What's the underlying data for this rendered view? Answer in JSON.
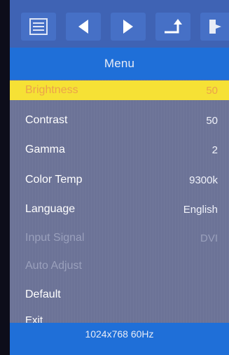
{
  "toolbar": {
    "buttons": [
      {
        "icon": "menu-list-icon"
      },
      {
        "icon": "arrow-left-icon"
      },
      {
        "icon": "arrow-right-icon"
      },
      {
        "icon": "enter-return-icon"
      },
      {
        "icon": "exit-door-icon"
      }
    ]
  },
  "menu": {
    "title": "Menu",
    "items": [
      {
        "label": "Brightness",
        "value": "50",
        "state": "selected"
      },
      {
        "label": "Contrast",
        "value": "50",
        "state": "normal"
      },
      {
        "label": "Gamma",
        "value": "2",
        "state": "normal"
      },
      {
        "label": "Color Temp",
        "value": "9300k",
        "state": "normal"
      },
      {
        "label": "Language",
        "value": "English",
        "state": "normal"
      },
      {
        "label": "Input Signal",
        "value": "DVI",
        "state": "disabled"
      },
      {
        "label": "Auto Adjust",
        "value": "",
        "state": "disabled"
      },
      {
        "label": "Default",
        "value": "",
        "state": "normal"
      },
      {
        "label": "Exit",
        "value": "",
        "state": "normal"
      }
    ]
  },
  "status": {
    "resolution": "1024x768 60Hz"
  },
  "colors": {
    "toolbar": "#3f63b4",
    "title_bar": "#1f6fd8",
    "panel": "#6c7397",
    "highlight": "#f6e135",
    "highlight_text": "#eca24a"
  }
}
